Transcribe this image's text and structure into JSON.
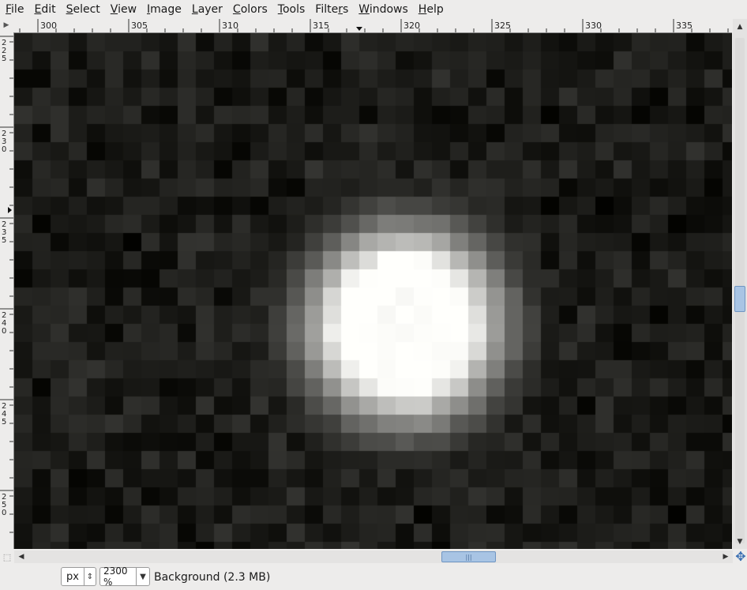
{
  "menubar": {
    "items": [
      {
        "label": "File",
        "mnemonic": "F",
        "rest": "ile"
      },
      {
        "label": "Edit",
        "mnemonic": "E",
        "rest": "dit"
      },
      {
        "label": "Select",
        "mnemonic": "S",
        "rest": "elect"
      },
      {
        "label": "View",
        "mnemonic": "V",
        "rest": "iew"
      },
      {
        "label": "Image",
        "mnemonic": "I",
        "rest": "mage"
      },
      {
        "label": "Layer",
        "mnemonic": "L",
        "rest": "ayer"
      },
      {
        "label": "Colors",
        "mnemonic": "C",
        "rest": "olors"
      },
      {
        "label": "Tools",
        "mnemonic": "T",
        "rest": "ools"
      },
      {
        "label": "Filters",
        "mnemonic": "r",
        "pre": "Filte",
        "rest": "s"
      },
      {
        "label": "Windows",
        "mnemonic": "W",
        "rest": "indows"
      },
      {
        "label": "Help",
        "mnemonic": "H",
        "rest": "elp"
      }
    ]
  },
  "rulers": {
    "horizontal_labels": [
      "300",
      "305",
      "310",
      "315",
      "320",
      "325",
      "330",
      "335"
    ],
    "vertical_labels": [
      "225",
      "230",
      "235",
      "240",
      "245",
      "250"
    ],
    "pixels_per_unit_note": "zoom 2300%"
  },
  "statusbar": {
    "unit": "px",
    "zoom": "2300 %",
    "layer_info": "Background (2.3 MB)"
  },
  "colors": {
    "chrome_bg": "#edeceb",
    "scroll_thumb": "#a8c4e4",
    "canvas_dark": "#0d0d0d",
    "star_core": "#ffffff"
  },
  "icons": {
    "ruler_corner": "ruler-menu-icon",
    "navigate": "navigate-icon",
    "quick_mask": "quick-mask-icon"
  }
}
